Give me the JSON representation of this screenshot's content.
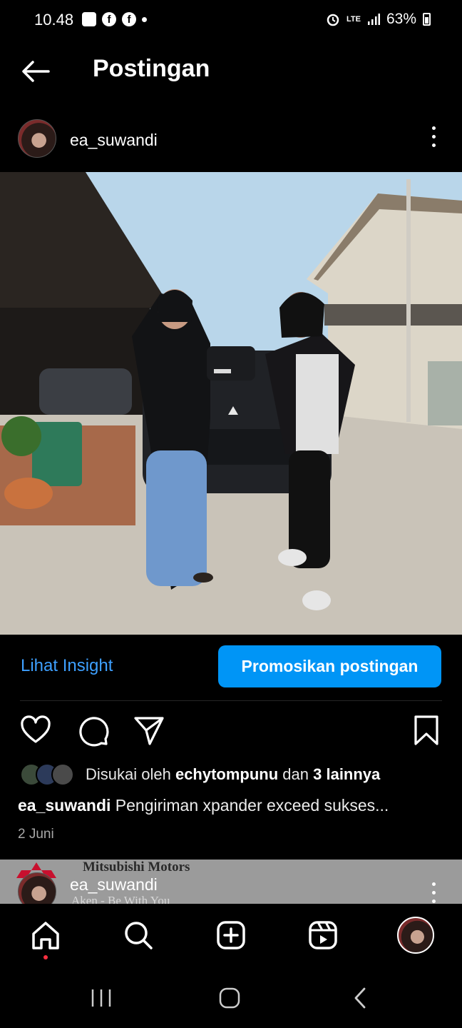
{
  "status_bar": {
    "time": "10.48",
    "network": "LTE",
    "battery": "63%",
    "icons": [
      "gallery-icon",
      "facebook-icon",
      "facebook-icon",
      "dot-icon",
      "alarm-icon",
      "lte-icon",
      "signal-icon",
      "battery-icon"
    ]
  },
  "header": {
    "title": "Postingan",
    "back_icon": "arrow-left-icon"
  },
  "post": {
    "author": "ea_suwandi",
    "photo_alt": "photo",
    "insight_label": "Lihat Insight",
    "promote_label": "Promosikan postingan",
    "likes_prefix": "Disukai oleh ",
    "likes_user": "echytompunu",
    "likes_mid": " dan ",
    "likes_count": "3 lainnya",
    "caption_user": "ea_suwandi",
    "caption_text": " Pengiriman xpander exceed sukses...",
    "date": "2 Juni"
  },
  "next_post": {
    "author": "ea_suwandi",
    "brand": "Mitsubishi Motors",
    "tagline": "Aken - Be With You"
  },
  "colors": {
    "accent": "#0095f6",
    "link": "#3ea0ff",
    "notif": "#ff3040"
  }
}
